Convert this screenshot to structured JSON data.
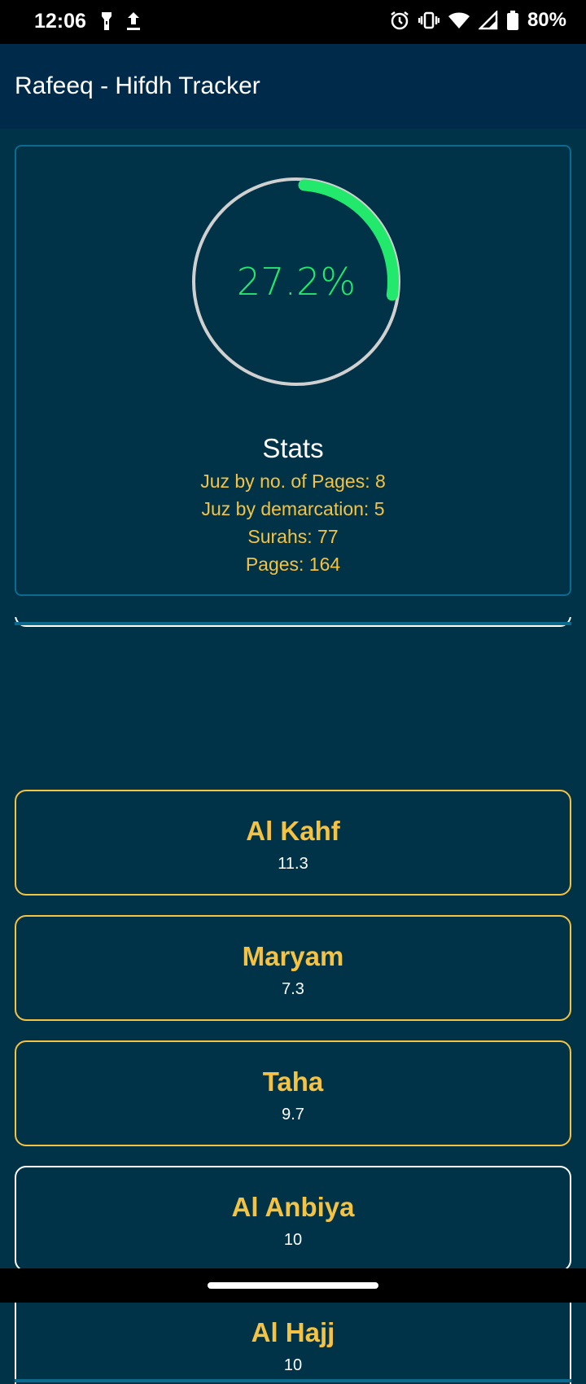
{
  "status_bar": {
    "time": "12:06",
    "battery_text": "80%",
    "icons_left": [
      "flashlight-icon",
      "upload-icon"
    ],
    "icons_right": [
      "alarm-icon",
      "vibrate-icon",
      "wifi-icon",
      "signal-icon",
      "battery-icon"
    ]
  },
  "app_bar": {
    "title": "Rafeeq - Hifdh Tracker"
  },
  "progress": {
    "percent_text": "27.2%",
    "fraction": 0.272,
    "color": "#22e86c"
  },
  "stats": {
    "title": "Stats",
    "lines": [
      "Juz by no. of Pages: 8",
      "Juz by demarcation: 5",
      "Surahs: 77",
      "Pages: 164"
    ]
  },
  "surahs": [
    {
      "name": "Al Kahf",
      "value": "11.3",
      "border": "gold"
    },
    {
      "name": "Maryam",
      "value": "7.3",
      "border": "gold"
    },
    {
      "name": "Taha",
      "value": "9.7",
      "border": "gold"
    },
    {
      "name": "Al Anbiya",
      "value": "10",
      "border": "white"
    },
    {
      "name": "Al Hajj",
      "value": "10",
      "border": "white"
    }
  ],
  "colors": {
    "background": "#003347",
    "accent_gold": "#f5c242",
    "accent_green": "#22e86c"
  }
}
